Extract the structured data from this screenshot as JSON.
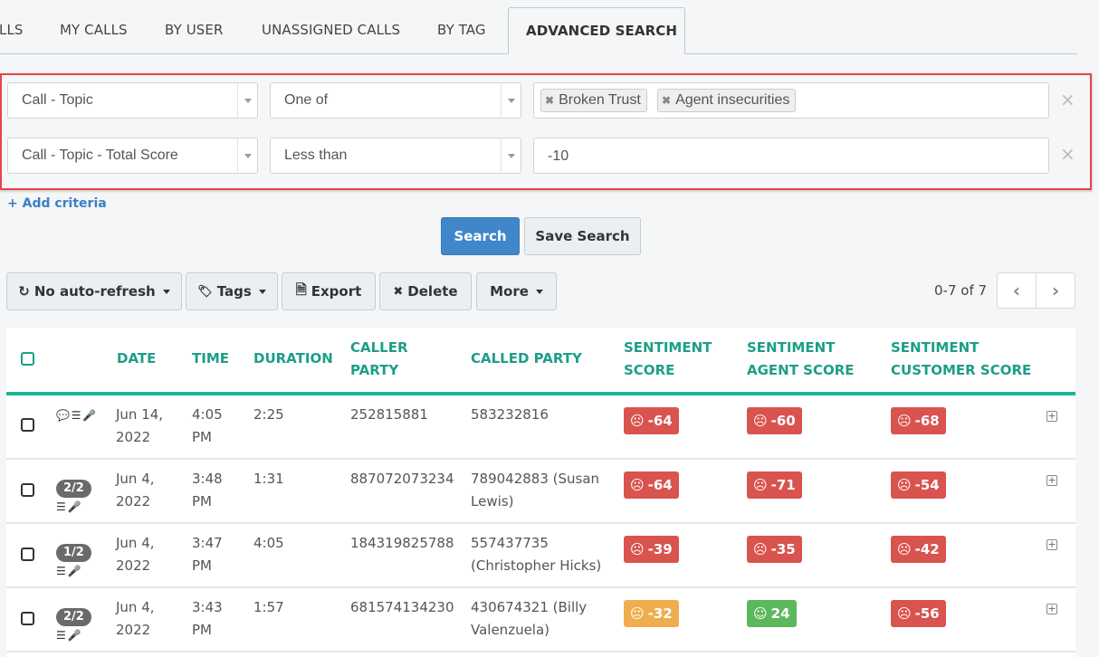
{
  "tabs": [
    {
      "label": "LLS",
      "active": false
    },
    {
      "label": "MY CALLS",
      "active": false
    },
    {
      "label": "BY USER",
      "active": false
    },
    {
      "label": "UNASSIGNED CALLS",
      "active": false
    },
    {
      "label": "BY TAG",
      "active": false
    },
    {
      "label": "ADVANCED SEARCH",
      "active": true
    }
  ],
  "criteria": [
    {
      "field": "Call - Topic",
      "operator": "One of",
      "chips": [
        "Broken Trust",
        "Agent insecurities"
      ],
      "value": ""
    },
    {
      "field": "Call - Topic - Total Score",
      "operator": "Less than",
      "chips": [],
      "value": "-10"
    }
  ],
  "remove_symbol": "×",
  "chip_remove_symbol": "✖",
  "add_criteria_label": "+ Add criteria",
  "search_button": "Search",
  "save_search_button": "Save Search",
  "toolbar": {
    "auto_refresh": {
      "label": "No auto-refresh",
      "icon": "↻"
    },
    "tags": {
      "label": "Tags",
      "icon": "🏷"
    },
    "export": {
      "label": "Export",
      "icon": "🗎"
    },
    "delete": {
      "label": "Delete",
      "icon": "✖"
    },
    "more": {
      "label": "More"
    }
  },
  "pagination": {
    "text": "0-7 of 7",
    "prev": "‹",
    "next": "›"
  },
  "table": {
    "columns": {
      "date": "DATE",
      "time": "TIME",
      "duration": "DURATION",
      "caller_1": "CALLER",
      "caller_2": "PARTY",
      "called": "CALLED PARTY",
      "sent_1": "SENTIMENT",
      "sent_2": "SCORE",
      "agent_1": "SENTIMENT",
      "agent_2": "AGENT SCORE",
      "cust_1": "SENTIMENT",
      "cust_2": "CUSTOMER SCORE"
    },
    "rows": [
      {
        "badge": "",
        "icons": "💬 ☰ 🎤",
        "date_1": "Jun 14,",
        "date_2": "2022",
        "time_1": "4:05",
        "time_2": "PM",
        "duration": "2:25",
        "caller": "252815881",
        "called_1": "583232816",
        "called_2": "",
        "sentiment": {
          "value": "-64",
          "mood": "neg",
          "face": "☹"
        },
        "agent": {
          "value": "-60",
          "mood": "neg",
          "face": "☹"
        },
        "customer": {
          "value": "-68",
          "mood": "neg",
          "face": "☹"
        }
      },
      {
        "badge": "2/2",
        "icons": "☰ 🎤",
        "date_1": "Jun 4,",
        "date_2": "2022",
        "time_1": "3:48",
        "time_2": "PM",
        "duration": "1:31",
        "caller": "887072073234",
        "called_1": "789042883 (Susan",
        "called_2": "Lewis)",
        "sentiment": {
          "value": "-64",
          "mood": "neg",
          "face": "☹"
        },
        "agent": {
          "value": "-71",
          "mood": "neg",
          "face": "☹"
        },
        "customer": {
          "value": "-54",
          "mood": "neg",
          "face": "☹"
        }
      },
      {
        "badge": "1/2",
        "icons": "☰ 🎤",
        "date_1": "Jun 4,",
        "date_2": "2022",
        "time_1": "3:47",
        "time_2": "PM",
        "duration": "4:05",
        "caller": "184319825788",
        "called_1": "557437735",
        "called_2": "(Christopher Hicks)",
        "sentiment": {
          "value": "-39",
          "mood": "neg",
          "face": "☹"
        },
        "agent": {
          "value": "-35",
          "mood": "neg",
          "face": "☹"
        },
        "customer": {
          "value": "-42",
          "mood": "neg",
          "face": "☹"
        }
      },
      {
        "badge": "2/2",
        "icons": "☰ 🎤",
        "date_1": "Jun 4,",
        "date_2": "2022",
        "time_1": "3:43",
        "time_2": "PM",
        "duration": "1:57",
        "caller": "681574134230",
        "called_1": "430674321 (Billy",
        "called_2": "Valenzuela)",
        "sentiment": {
          "value": "-32",
          "mood": "neu",
          "face": "😐"
        },
        "agent": {
          "value": "24",
          "mood": "pos",
          "face": "☺"
        },
        "customer": {
          "value": "-56",
          "mood": "neg",
          "face": "☹"
        }
      }
    ],
    "expand_symbol": "+"
  },
  "colors": {
    "accent": "#1ab394",
    "primary": "#3f87c9",
    "negative": "#d9534f",
    "neutral": "#f0ad4e",
    "positive": "#5cb85c",
    "highlight": "#e8444a"
  }
}
